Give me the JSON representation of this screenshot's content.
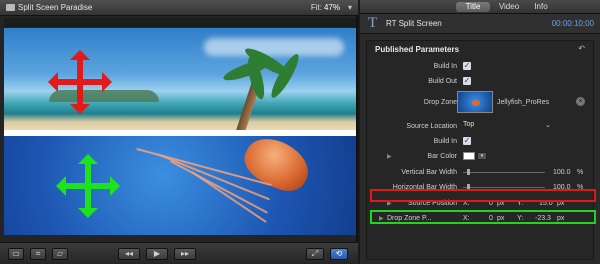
{
  "viewer": {
    "title": "Split Sceen Paradise",
    "fit_label": "Fit:",
    "fit_value": "47%",
    "arrows": {
      "top_color": "#e21a1a",
      "bottom_color": "#1de21d"
    }
  },
  "transport": {
    "icons": [
      "filmstrip-icon",
      "crop-icon",
      "distort-icon",
      "rewind-icon",
      "play-icon",
      "forward-icon",
      "fullscreen-icon",
      "loop-icon"
    ]
  },
  "inspector": {
    "tabs": [
      "Title",
      "Video",
      "Info"
    ],
    "active_tab": "Title",
    "title_icon": "T",
    "effect_name": "RT Split Screen",
    "timecode": "00:00:10;00",
    "section": "Published Parameters",
    "reset_glyph": "↶",
    "rows": {
      "build_in": "Build In",
      "build_out": "Build Out",
      "drop_zone": "Drop Zone",
      "drop_zone_clip": "Jellyfish_ProRes",
      "source_location": "Source Location",
      "source_location_value": "Top",
      "build_in_2": "Build In",
      "bar_color": "Bar Color",
      "vertical_bar_width": "Vertical Bar Width",
      "vertical_bar_value": "100.0",
      "vertical_bar_unit": "%",
      "horizontal_bar_width": "Horizontal Bar Width",
      "horizontal_bar_value": "100.0",
      "horizontal_bar_unit": "%",
      "source_position": "Source Position",
      "source_x_label": "X:",
      "source_x_value": "0",
      "source_x_unit": "px",
      "source_y_label": "Y:",
      "source_y_value": "15.0",
      "source_y_unit": "px",
      "drop_zone_position": "Drop Zone P...",
      "dz_x_label": "X:",
      "dz_x_value": "0",
      "dz_x_unit": "px",
      "dz_y_label": "Y:",
      "dz_y_value": "-23.3",
      "dz_y_unit": "px"
    },
    "highlight_colors": {
      "source_position": "#e01818",
      "drop_zone_position": "#1fd51f"
    }
  }
}
